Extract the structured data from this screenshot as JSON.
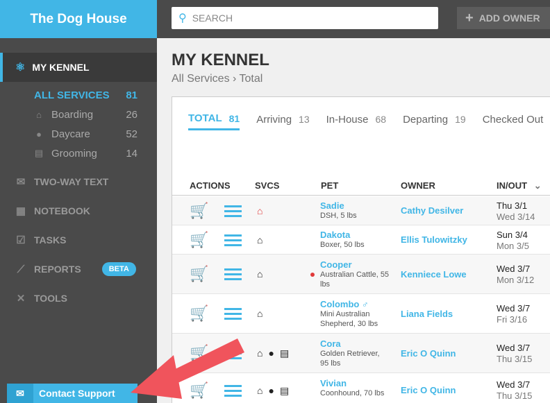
{
  "app": {
    "brand": "The Dog House"
  },
  "topbar": {
    "search_placeholder": "SEARCH",
    "add_owner": "ADD OWNER"
  },
  "sidebar": {
    "active": "MY KENNEL",
    "services": [
      {
        "label": "ALL SERVICES",
        "count": "81"
      },
      {
        "label": "Boarding",
        "count": "26"
      },
      {
        "label": "Daycare",
        "count": "52"
      },
      {
        "label": "Grooming",
        "count": "14"
      }
    ],
    "items": [
      {
        "label": "TWO-WAY TEXT"
      },
      {
        "label": "NOTEBOOK"
      },
      {
        "label": "TASKS"
      },
      {
        "label": "REPORTS",
        "badge": "BETA"
      },
      {
        "label": "TOOLS"
      }
    ],
    "support": "Contact Support"
  },
  "main": {
    "title": "MY KENNEL",
    "breadcrumb": "All Services › Total",
    "tabs": [
      {
        "label": "TOTAL",
        "count": "81"
      },
      {
        "label": "Arriving",
        "count": "13"
      },
      {
        "label": "In-House",
        "count": "68"
      },
      {
        "label": "Departing",
        "count": "19"
      },
      {
        "label": "Checked Out",
        "count": ""
      }
    ],
    "columns": [
      "ACTIONS",
      "SVCS",
      "PET",
      "OWNER",
      "IN/OUT"
    ],
    "rows": [
      {
        "pet": "Sadie",
        "desc": "DSH, 5 lbs",
        "owner": "Cathy Desilver",
        "in": "Thu 3/1",
        "out": "Wed 3/14"
      },
      {
        "pet": "Dakota",
        "desc": "Boxer, 50 lbs",
        "owner": "Ellis Tulowitzky",
        "in": "Sun 3/4",
        "out": "Mon 3/5"
      },
      {
        "pet": "Cooper",
        "desc": "Australian Cattle, 55 lbs",
        "owner": "Kenniece Lowe",
        "in": "Wed 3/7",
        "out": "Mon 3/12"
      },
      {
        "pet": "Colombo ♂",
        "desc": "Mini Australian Shepherd, 30 lbs",
        "owner": "Liana Fields",
        "in": "Wed 3/7",
        "out": "Fri 3/16"
      },
      {
        "pet": "Cora",
        "desc": "Golden Retriever, 95 lbs",
        "owner": "Eric O Quinn",
        "in": "Wed 3/7",
        "out": "Thu 3/15"
      },
      {
        "pet": "Vivian",
        "desc": "Coonhound, 70 lbs",
        "owner": "Eric O Quinn",
        "in": "Wed 3/7",
        "out": "Thu 3/15"
      }
    ]
  },
  "colors": {
    "accent": "#41b6e6",
    "sidebar": "#4a4a4a",
    "arrow": "#f0545c"
  }
}
